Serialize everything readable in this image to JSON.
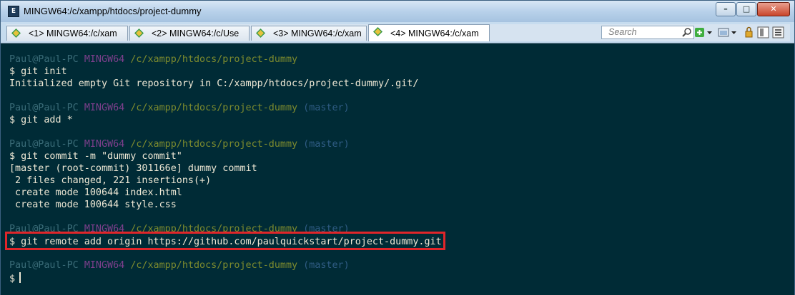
{
  "window": {
    "title": "MINGW64:/c/xampp/htdocs/project-dummy"
  },
  "tabs": [
    {
      "label": "<1> MINGW64:/c/xam"
    },
    {
      "label": "<2> MINGW64:/c/Use"
    },
    {
      "label": "<3> MINGW64:/c/xam"
    },
    {
      "label": "<4> MINGW64:/c/xam"
    }
  ],
  "search": {
    "placeholder": "Search"
  },
  "prompt": {
    "user": "Paul@Paul-PC",
    "msystem": "MINGW64",
    "path": "/c/xampp/htdocs/project-dummy",
    "branch": "(master)",
    "symbol": "$"
  },
  "terminal": {
    "cmd_init": "git init",
    "out_init": "Initialized empty Git repository in C:/xampp/htdocs/project-dummy/.git/",
    "cmd_add": "git add *",
    "cmd_commit": "git commit -m \"dummy commit\"",
    "out_commit_1": "[master (root-commit) 301166e] dummy commit",
    "out_commit_2": " 2 files changed, 221 insertions(+)",
    "out_commit_3": " create mode 100644 index.html",
    "out_commit_4": " create mode 100644 style.css",
    "cmd_remote": "git remote add origin https://github.com/paulquickstart/project-dummy.git"
  },
  "colors": {
    "background": "#002b36",
    "highlight_box": "#e0262a",
    "user": "#3a6c78",
    "msystem": "#7d3f8c",
    "path": "#7d8b2e",
    "branch": "#2f5c84"
  }
}
